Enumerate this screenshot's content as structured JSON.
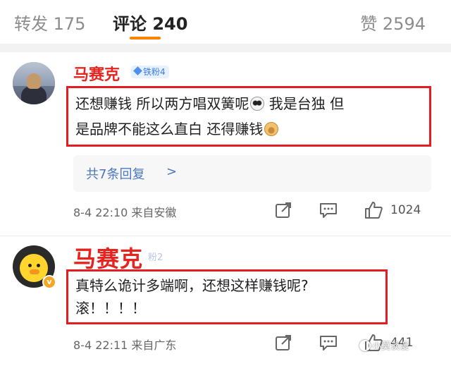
{
  "tabs": {
    "forward": "转发 175",
    "comment": "评论 240",
    "like": "赞 2594"
  },
  "comments": [
    {
      "username": "马赛克",
      "badge": "铁粉4",
      "text_line1": "还想赚钱 所以两方唱双簧呢",
      "text_line1b": " 我是台独 但",
      "text_line2": "是品牌不能这么直白 还得赚钱",
      "reply_link": "共7条回复",
      "reply_chevron": ">",
      "time": "8-4 22:10",
      "location": "来自安徽",
      "likes": "1024"
    },
    {
      "username": "马赛克",
      "badge": "粉2",
      "verified": "v",
      "text_line1": "真特么诡计多端啊，还想这样赚钱呢?",
      "text_line2": "滚！！！！",
      "time": "8-4 22:11",
      "location": "来自广东",
      "likes": "441"
    }
  ],
  "watermark": "小莫谈漫",
  "colors": {
    "accent": "#ff8200",
    "highlight_box": "#e31b23",
    "username_red": "#e8231e",
    "link_blue": "#4a78c2"
  },
  "icons": [
    "share-icon",
    "reply-icon",
    "like-icon",
    "panda-emoji-icon",
    "doge-emoji-icon",
    "chevron-right-icon"
  ]
}
